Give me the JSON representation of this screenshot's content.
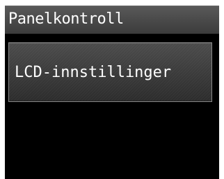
{
  "header": {
    "title": "Panelkontroll"
  },
  "menu": {
    "items": [
      {
        "label": "LCD-innstillinger"
      }
    ]
  },
  "colors": {
    "screen_background": "#000000",
    "title_bar": "#4a4a4a",
    "button_background": "#3a3a3a",
    "button_border": "#8a8a8a",
    "text": "#ffffff"
  }
}
